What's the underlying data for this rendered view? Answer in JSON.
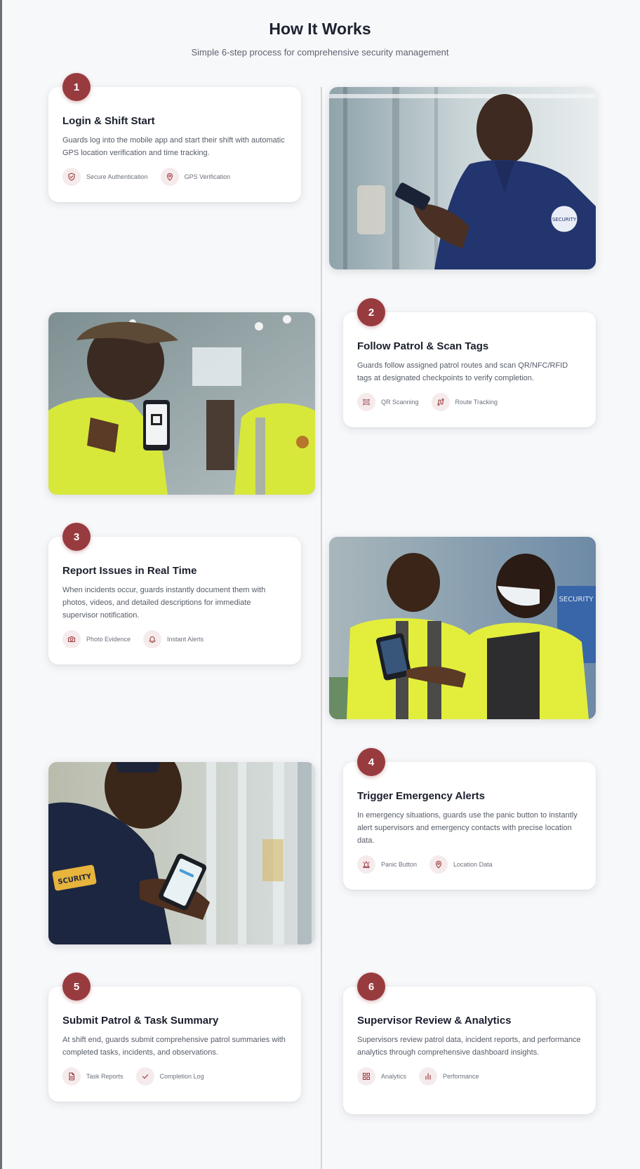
{
  "header": {
    "title": "How It Works",
    "subtitle": "Simple 6-step process for comprehensive security management"
  },
  "steps": [
    {
      "number": "1",
      "title": "Login & Shift Start",
      "description": "Guards log into the mobile app and start their shift with automatic GPS location verification and time tracking.",
      "features": [
        {
          "icon": "shield-icon",
          "label": "Secure Authentication"
        },
        {
          "icon": "location-pin-icon",
          "label": "GPS Verification"
        }
      ]
    },
    {
      "number": "2",
      "title": "Follow Patrol & Scan Tags",
      "description": "Guards follow assigned patrol routes and scan QR/NFC/RFID tags at designated checkpoints to verify completion.",
      "features": [
        {
          "icon": "scan-icon",
          "label": "QR Scanning"
        },
        {
          "icon": "route-icon",
          "label": "Route Tracking"
        }
      ]
    },
    {
      "number": "3",
      "title": "Report Issues in Real Time",
      "description": "When incidents occur, guards instantly document them with photos, videos, and detailed descriptions for immediate supervisor notification.",
      "features": [
        {
          "icon": "camera-icon",
          "label": "Photo Evidence"
        },
        {
          "icon": "bell-icon",
          "label": "Instant Alerts"
        }
      ]
    },
    {
      "number": "4",
      "title": "Trigger Emergency Alerts",
      "description": "In emergency situations, guards use the panic button to instantly alert supervisors and emergency contacts with precise location data.",
      "features": [
        {
          "icon": "siren-icon",
          "label": "Panic Button"
        },
        {
          "icon": "location-pin-icon",
          "label": "Location Data"
        }
      ]
    },
    {
      "number": "5",
      "title": "Submit Patrol & Task Summary",
      "description": "At shift end, guards submit comprehensive patrol summaries with completed tasks, incidents, and observations.",
      "features": [
        {
          "icon": "document-icon",
          "label": "Task Reports"
        },
        {
          "icon": "check-icon",
          "label": "Completion Log"
        }
      ]
    },
    {
      "number": "6",
      "title": "Supervisor Review & Analytics",
      "description": "Supervisors review patrol data, incident reports, and performance analytics through comprehensive dashboard insights.",
      "features": [
        {
          "icon": "dashboard-icon",
          "label": "Analytics"
        },
        {
          "icon": "bar-chart-icon",
          "label": "Performance"
        }
      ]
    }
  ],
  "photos": [
    {
      "name": "photo-guard-login",
      "patch_text": "SECURITY"
    },
    {
      "name": "photo-guard-scanning"
    },
    {
      "name": "photo-guards-reporting",
      "sign_text": "SECURITY"
    },
    {
      "name": "photo-guard-emergency",
      "patch_text": "SCURITY"
    }
  ],
  "colors": {
    "accent": "#983b3f",
    "accent_soft": "#f6ebec",
    "background": "#f7f8fa",
    "timeline": "#dccfd2"
  }
}
